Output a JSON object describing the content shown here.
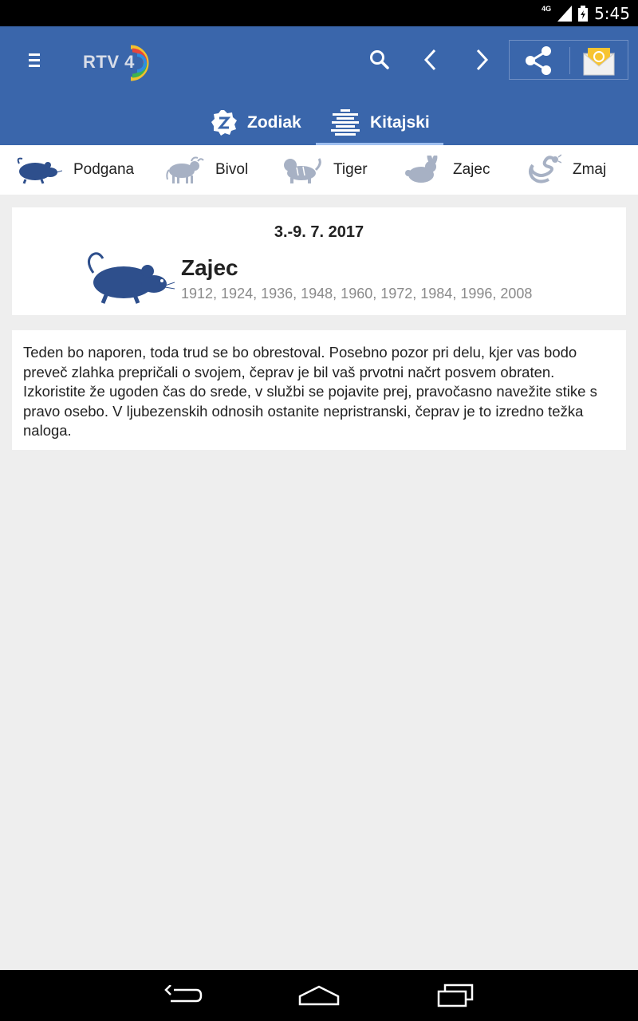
{
  "status_bar": {
    "network": "4G",
    "time": "5:45"
  },
  "app": {
    "logo_text": "RTV 4"
  },
  "tabs": [
    {
      "label": "Zodiak"
    },
    {
      "label": "Kitajski"
    }
  ],
  "animals": [
    {
      "label": "Podgana",
      "icon": "rat-icon"
    },
    {
      "label": "Bivol",
      "icon": "ox-icon"
    },
    {
      "label": "Tiger",
      "icon": "tiger-icon"
    },
    {
      "label": "Zajec",
      "icon": "rabbit-icon"
    },
    {
      "label": "Zmaj",
      "icon": "dragon-icon"
    }
  ],
  "horoscope": {
    "date_range": "3.-9. 7. 2017",
    "sign_name": "Zajec",
    "years": "1912, 1924, 1936, 1948, 1960, 1972, 1984, 1996, 2008",
    "text": "Teden bo naporen, toda trud se bo obrestoval. Posebno pozor pri delu, kjer vas bodo preveč zlahka prepričali o svojem, čeprav je bil vaš prvotni načrt posvem obraten. Izkoristite že ugoden čas do srede, v službi se pojavite prej, pravočasno navežite stike s pravo osebo. V ljubezenskih odnosih ostanite nepristranski, čeprav je to izredno težka naloga."
  },
  "colors": {
    "app_bar": "#3a66ab",
    "active_animal": "#2e4f8c",
    "inactive_animal": "#a7b1c4"
  }
}
